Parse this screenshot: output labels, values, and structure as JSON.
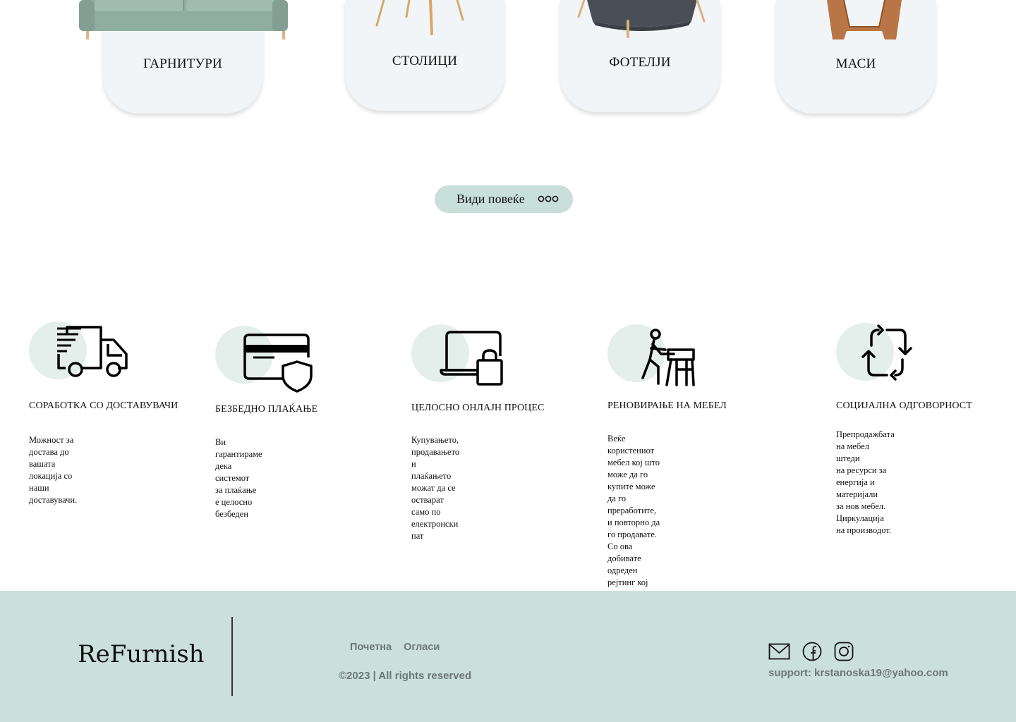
{
  "categories": [
    {
      "label": "ГАРНИТУРИ",
      "icon": "sofa-image"
    },
    {
      "label": "СТОЛИЦИ",
      "icon": "chair-image"
    },
    {
      "label": "ФОТЕЛЈИ",
      "icon": "armchair-image"
    },
    {
      "label": "МАСИ",
      "icon": "table-image"
    }
  ],
  "view_more": {
    "label": "Види повеќе",
    "icon": "ellipsis-icon"
  },
  "features": [
    {
      "icon": "delivery-truck-icon",
      "title": "СОРАБОТКА СО ДОСТАВУВАЧИ",
      "description": "Можност за достава до вашата\nлокација со наши доставувачи."
    },
    {
      "icon": "secure-card-icon",
      "title": "БЕЗБЕДНО ПЛАЌАЊЕ",
      "description": "Ви гарантираме дека системот\nза плаќање е целосно безбеден"
    },
    {
      "icon": "laptop-shopping-icon",
      "title": "ЦЕЛОСНО ОНЛАЈН ПРОЦЕС",
      "description": "Купувањето, продавањето и\nплаќањето можат да се остварат\nсамо по електронски пат"
    },
    {
      "icon": "carpenter-icon",
      "title": "РЕНОВИРАЊЕ НА МЕБЕЛ",
      "description": "Веќе користениот мебел кој што\nможе да го купите може да го преработите,\nи повторно да го продавате.\nСо ова добивате одреден рејтинг кој\nнуди дополнителни привилегии."
    },
    {
      "icon": "recycle-arrows-icon",
      "title": "СОЦИЈАЛНА ОДГОВОРНОСТ",
      "description": "Препродажбата на мебел штеди\nна ресурси за енергија и материјали\nза нов мебел.\nЦиркулација на производот."
    }
  ],
  "footer": {
    "logo": "ReFurnish",
    "links": [
      "Почетна",
      "Огласи"
    ],
    "copyright": "©2023 | All rights reserved",
    "social": [
      "mail-icon",
      "facebook-icon",
      "instagram-icon"
    ],
    "support": "support: krstanoska19@yahoo.com",
    "background": "#cbe0da"
  },
  "colors": {
    "card_bg": "#f1f5f8",
    "button_bg": "#c9dfd9",
    "blob": "#e4eeeb",
    "footer_text": "#6c7775"
  }
}
